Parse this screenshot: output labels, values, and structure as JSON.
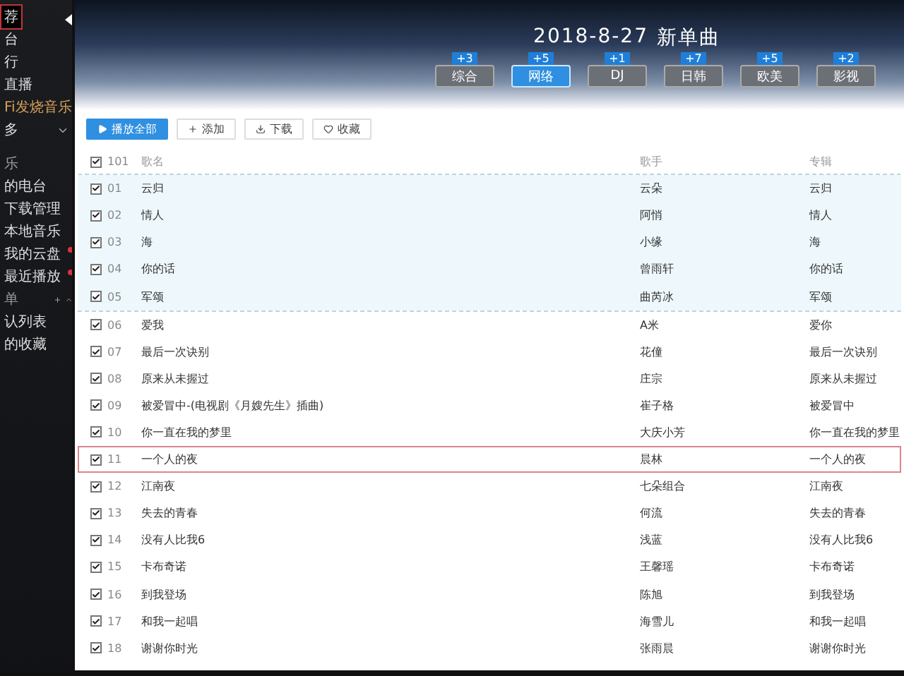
{
  "sidebar": {
    "items": [
      {
        "label": "荐",
        "kind": "item",
        "selected": true
      },
      {
        "label": "台",
        "kind": "item",
        "selected": false
      },
      {
        "label": "行",
        "kind": "item",
        "selected": false
      },
      {
        "label": "直播",
        "kind": "item",
        "selected": false
      },
      {
        "label": "Fi发烧音乐",
        "kind": "hifi",
        "selected": false
      },
      {
        "label": "多",
        "kind": "more",
        "selected": false
      },
      {
        "label": "乐",
        "kind": "header",
        "selected": false
      },
      {
        "label": "的电台",
        "kind": "item",
        "selected": false
      },
      {
        "label": "下载管理",
        "kind": "item",
        "selected": false
      },
      {
        "label": "本地音乐",
        "kind": "item",
        "selected": false
      },
      {
        "label": "我的云盘",
        "kind": "item",
        "selected": false,
        "dot": true
      },
      {
        "label": "最近播放",
        "kind": "item",
        "selected": false,
        "dot": true
      },
      {
        "label": "单",
        "kind": "playlist-header",
        "selected": false
      },
      {
        "label": "认列表",
        "kind": "item",
        "selected": false
      },
      {
        "label": "的收藏",
        "kind": "item",
        "selected": false
      }
    ]
  },
  "banner": {
    "date": "2018-8-27",
    "title": "新单曲",
    "tabs": [
      {
        "label": "综合",
        "badge": "+3",
        "selected": false
      },
      {
        "label": "网络",
        "badge": "+5",
        "selected": true
      },
      {
        "label": "DJ",
        "badge": "+1",
        "selected": false
      },
      {
        "label": "日韩",
        "badge": "+7",
        "selected": false
      },
      {
        "label": "欧美",
        "badge": "+5",
        "selected": false
      },
      {
        "label": "影视",
        "badge": "+2",
        "selected": false
      }
    ]
  },
  "toolbar": {
    "buttons": [
      {
        "label": "播放全部",
        "kind": "play"
      },
      {
        "label": "添加",
        "kind": "add"
      },
      {
        "label": "下载",
        "kind": "download"
      },
      {
        "label": "收藏",
        "kind": "favorite"
      }
    ]
  },
  "table": {
    "header": {
      "checked": true,
      "count": "101",
      "columns": [
        "歌名",
        "歌手",
        "专辑"
      ]
    },
    "rows": [
      {
        "num": "01",
        "title": "云归",
        "singer": "云朵",
        "album": "云归",
        "checked": true,
        "highlighted": true,
        "selected": false
      },
      {
        "num": "02",
        "title": "情人",
        "singer": "阿悄",
        "album": "情人",
        "checked": true,
        "highlighted": true,
        "selected": false
      },
      {
        "num": "03",
        "title": "海",
        "singer": "小缘",
        "album": "海",
        "checked": true,
        "highlighted": true,
        "selected": false
      },
      {
        "num": "04",
        "title": "你的话",
        "singer": "曾雨轩",
        "album": "你的话",
        "checked": true,
        "highlighted": true,
        "selected": false
      },
      {
        "num": "05",
        "title": "军颂",
        "singer": "曲芮冰",
        "album": "军颂",
        "checked": true,
        "highlighted": true,
        "selected": false
      },
      {
        "num": "06",
        "title": "爱我",
        "singer": "A米",
        "album": "爱你",
        "checked": true,
        "highlighted": false,
        "selected": false
      },
      {
        "num": "07",
        "title": "最后一次诀别",
        "singer": "花僮",
        "album": "最后一次诀别",
        "checked": true,
        "highlighted": false,
        "selected": false
      },
      {
        "num": "08",
        "title": "原来从未握过",
        "singer": "庄宗",
        "album": "原来从未握过",
        "checked": true,
        "highlighted": false,
        "selected": false
      },
      {
        "num": "09",
        "title": "被爱冒中-(电视剧《月嫂先生》插曲)",
        "singer": "崔子格",
        "album": "被爱冒中",
        "checked": true,
        "highlighted": false,
        "selected": false
      },
      {
        "num": "10",
        "title": "你一直在我的梦里",
        "singer": "大庆小芳",
        "album": "你一直在我的梦里",
        "checked": true,
        "highlighted": false,
        "selected": false
      },
      {
        "num": "11",
        "title": "一个人的夜",
        "singer": "晨林",
        "album": "一个人的夜",
        "checked": true,
        "highlighted": false,
        "selected": true
      },
      {
        "num": "12",
        "title": "江南夜",
        "singer": "七朵组合",
        "album": "江南夜",
        "checked": true,
        "highlighted": false,
        "selected": false
      },
      {
        "num": "13",
        "title": "失去的青春",
        "singer": "何流",
        "album": "失去的青春",
        "checked": true,
        "highlighted": false,
        "selected": false
      },
      {
        "num": "14",
        "title": "没有人比我6",
        "singer": "浅蓝",
        "album": "没有人比我6",
        "checked": true,
        "highlighted": false,
        "selected": false
      },
      {
        "num": "15",
        "title": "卡布奇诺",
        "singer": "王馨瑶",
        "album": "卡布奇诺",
        "checked": true,
        "highlighted": false,
        "selected": false
      },
      {
        "num": "16",
        "title": "到我登场",
        "singer": "陈旭",
        "album": "到我登场",
        "checked": true,
        "highlighted": false,
        "selected": false
      },
      {
        "num": "17",
        "title": "和我一起唱",
        "singer": "海雪儿",
        "album": "和我一起唱",
        "checked": true,
        "highlighted": false,
        "selected": false
      },
      {
        "num": "18",
        "title": "谢谢你时光",
        "singer": "张雨晨",
        "album": "谢谢你时光",
        "checked": true,
        "highlighted": false,
        "selected": false
      }
    ]
  }
}
